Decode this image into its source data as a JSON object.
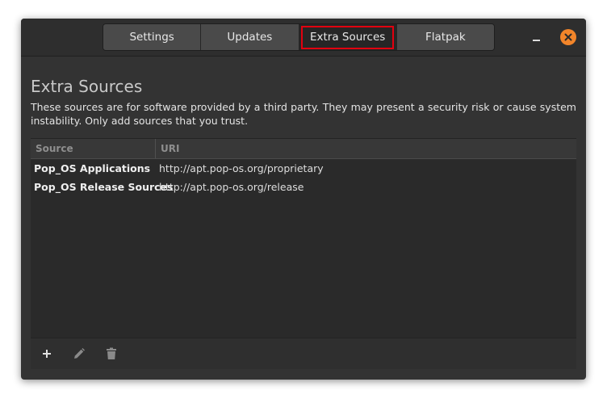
{
  "tabs": [
    {
      "label": "Settings"
    },
    {
      "label": "Updates"
    },
    {
      "label": "Extra Sources"
    },
    {
      "label": "Flatpak"
    }
  ],
  "active_tab": "Extra Sources",
  "colors": {
    "close_button": "#f2852a",
    "highlight_box": "#e2000f"
  },
  "page": {
    "title": "Extra Sources",
    "description": "These sources are for software provided by a third party. They may present a security risk or cause system instability. Only add sources that you trust."
  },
  "table": {
    "columns": {
      "source": "Source",
      "uri": "URI"
    },
    "rows": [
      {
        "source": "Pop_OS Applications",
        "uri": "http://apt.pop-os.org/proprietary"
      },
      {
        "source": "Pop_OS Release Sources",
        "uri": "http://apt.pop-os.org/release"
      }
    ]
  },
  "toolbar": {
    "icons": [
      "plus-icon",
      "pencil-icon",
      "trash-icon"
    ]
  }
}
